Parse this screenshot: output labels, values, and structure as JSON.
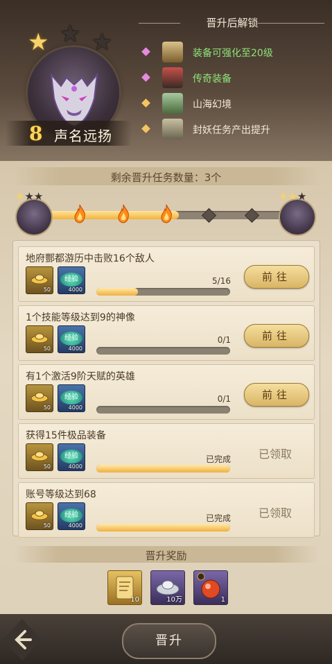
{
  "header": {
    "level_number": "8",
    "level_title": "声名远扬",
    "stars_filled": 1,
    "stars_total": 3
  },
  "unlock": {
    "title": "晋升后解锁",
    "items": [
      {
        "text": "装备可强化至20级",
        "color": "#8fe37a",
        "diamond": "#e58ae0",
        "icon": "equipment-upgrade-icon"
      },
      {
        "text": "传奇装备",
        "color": "#8fe37a",
        "diamond": "#e58ae0",
        "icon": "legendary-equipment-icon"
      },
      {
        "text": "山海幻境",
        "color": "#f4ead8",
        "diamond": "#f3c562",
        "icon": "shanhai-realm-icon"
      },
      {
        "text": "封妖任务产出提升",
        "color": "#f4ead8",
        "diamond": "#f3c562",
        "icon": "demon-sealing-task-icon"
      }
    ]
  },
  "progress": {
    "remaining_label": "剩余晋升任务数量：3个",
    "completed_nodes": 3,
    "total_nodes": 5,
    "fill_fraction": 0.55
  },
  "tasks": [
    {
      "title": "地府酆都游历中击败16个敌人",
      "gold_qty": "50",
      "exp_label": "经验",
      "exp_qty": "4000",
      "progress_text": "5/16",
      "fraction": 0.3125,
      "state": "go",
      "button_label": "前往"
    },
    {
      "title": "1个技能等级达到9的神像",
      "gold_qty": "50",
      "exp_label": "经验",
      "exp_qty": "4000",
      "progress_text": "0/1",
      "fraction": 0,
      "state": "go",
      "button_label": "前往"
    },
    {
      "title": "有1个激活9阶天赋的英雄",
      "gold_qty": "50",
      "exp_label": "经验",
      "exp_qty": "4000",
      "progress_text": "0/1",
      "fraction": 0,
      "state": "go",
      "button_label": "前往"
    },
    {
      "title": "获得15件极品装备",
      "gold_qty": "50",
      "exp_label": "经验",
      "exp_qty": "4000",
      "progress_text": "已完成",
      "fraction": 1,
      "state": "claimed",
      "button_label": "已领取"
    },
    {
      "title": "账号等级达到68",
      "gold_qty": "50",
      "exp_label": "经验",
      "exp_qty": "4000",
      "progress_text": "已完成",
      "fraction": 1,
      "state": "claimed",
      "button_label": "已领取"
    }
  ],
  "rewards": {
    "title": "晋升奖励",
    "items": [
      {
        "icon": "scroll-icon",
        "qty": "10"
      },
      {
        "icon": "silver-ingot-icon",
        "qty": "10万"
      },
      {
        "icon": "red-orb-icon",
        "qty": "1"
      }
    ]
  },
  "bottom": {
    "promote_label": "晋升"
  },
  "colors": {
    "accent_gold": "#f2b33c",
    "text_dark": "#4a3a28"
  }
}
